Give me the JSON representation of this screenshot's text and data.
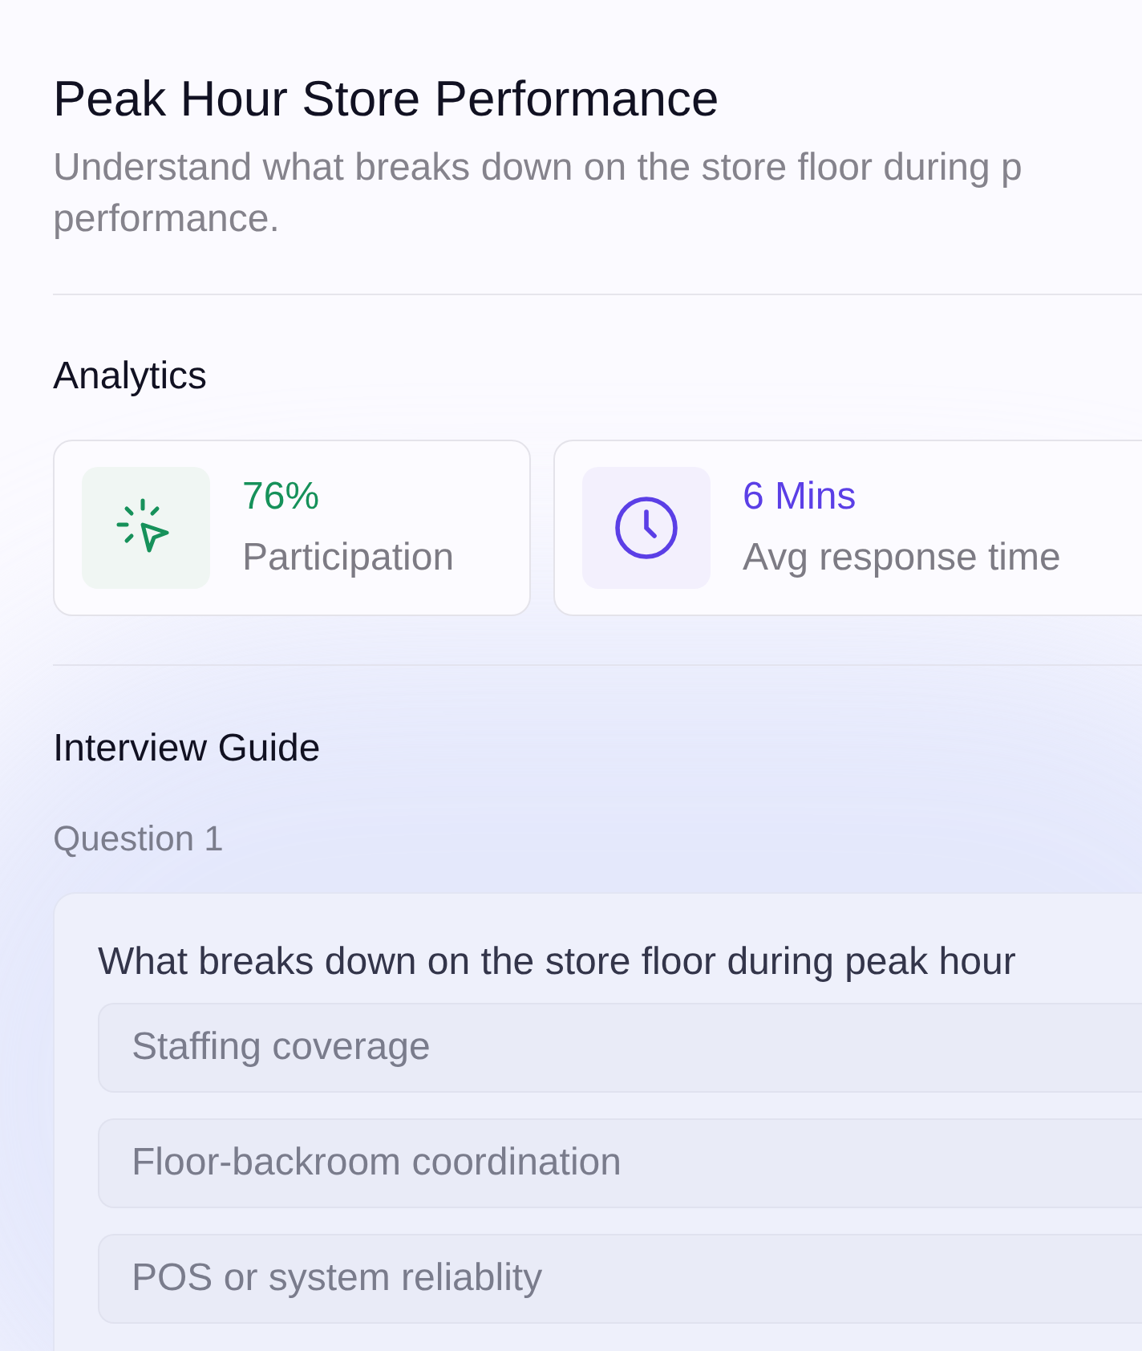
{
  "header": {
    "title": "Peak Hour Store Performance",
    "description": "Understand what breaks down on the store floor during p",
    "description_line2": "performance."
  },
  "analytics": {
    "heading": "Analytics",
    "metrics": [
      {
        "kind": "participation",
        "value": "76%",
        "label": "Participation",
        "color": "#16915a"
      },
      {
        "kind": "response",
        "value": "6 Mins",
        "label": "Avg response time",
        "color": "#5b3fe6"
      }
    ]
  },
  "interview_guide": {
    "heading": "Interview Guide",
    "question_label": "Question 1",
    "question": "What breaks down on the store floor during peak hour",
    "options": [
      "Staffing coverage",
      "Floor-backroom coordination",
      "POS or system reliablity"
    ]
  }
}
